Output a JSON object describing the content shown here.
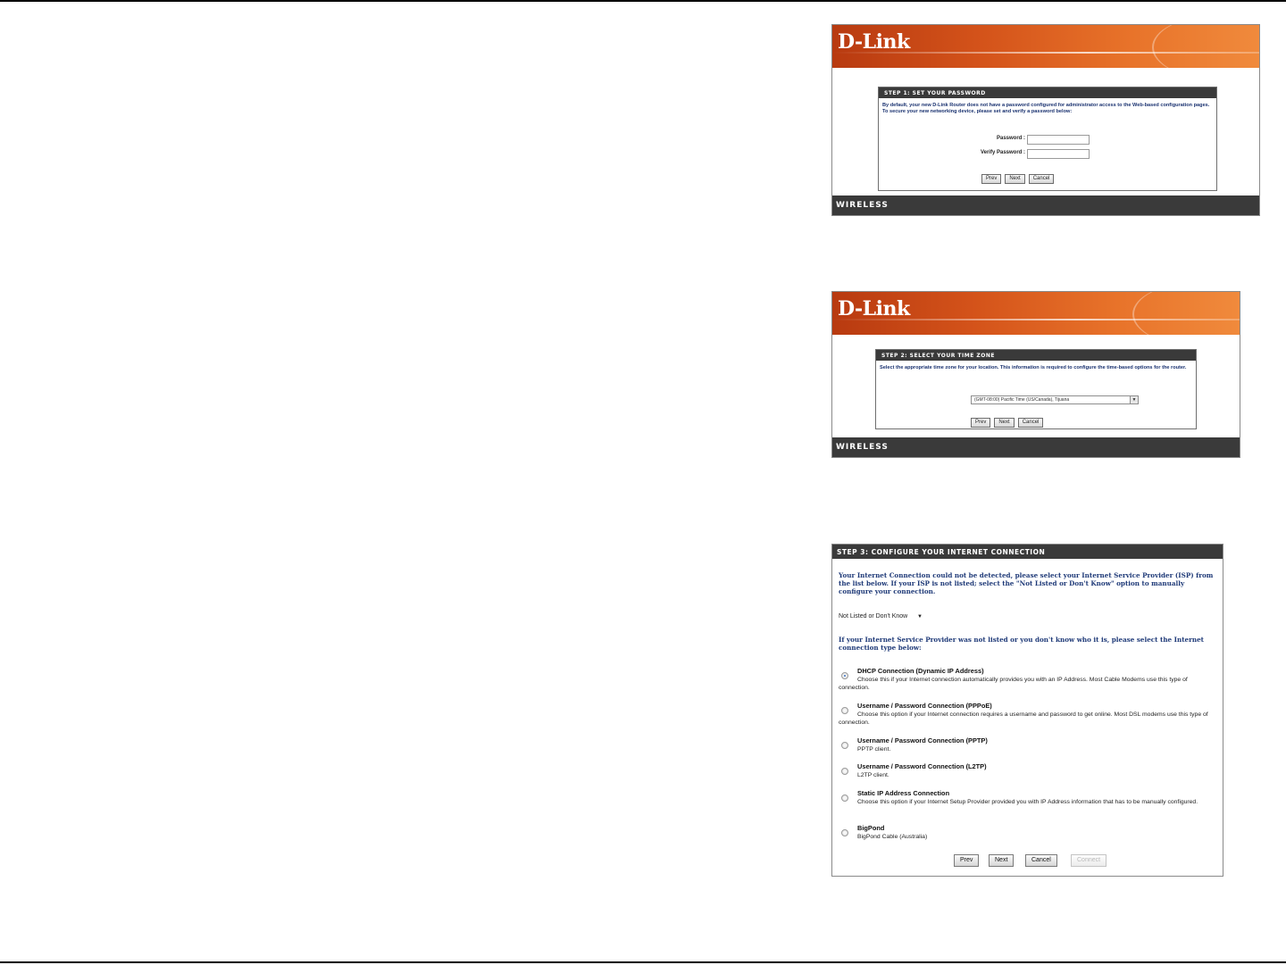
{
  "step1": {
    "logo": "D-Link",
    "heading": "STEP 1: SET YOUR PASSWORD",
    "description": "By default, your new D-Link Router does not have a password configured for administrator access to the Web-based configuration pages. To secure your new networking device, please set and verify a password below:",
    "password_label": "Password :",
    "verify_label": "Verify Password :",
    "password_value": "",
    "verify_value": "",
    "buttons": {
      "prev": "Prev",
      "next": "Next",
      "cancel": "Cancel"
    },
    "footer": "WIRELESS"
  },
  "step2": {
    "logo": "D-Link",
    "heading": "STEP 2: SELECT YOUR TIME ZONE",
    "description": "Select the appropriate time zone for your location. This information is required to configure the time-based options for the router.",
    "timezone_value": "(GMT-08:00) Pacific Time (US/Canada), Tijuana",
    "buttons": {
      "prev": "Prev",
      "next": "Next",
      "cancel": "Cancel"
    },
    "footer": "WIRELESS"
  },
  "step3": {
    "heading": "STEP 3: CONFIGURE YOUR INTERNET CONNECTION",
    "intro": "Your Internet Connection could not be detected, please select your Internet Service Provider (ISP) from the list below. If your ISP is not listed; select the \"Not Listed or Don't Know\" option to manually configure your connection.",
    "isp_select_value": "Not Listed or Don't Know",
    "instruction": "If your Internet Service Provider was not listed or you don't know who it is, please select the Internet connection type below:",
    "options": [
      {
        "title": "DHCP Connection (Dynamic IP Address)",
        "desc": "Choose this if your Internet connection automatically provides you with an IP Address. Most Cable Modems use this type of connection.",
        "selected": true
      },
      {
        "title": "Username / Password Connection (PPPoE)",
        "desc": "Choose this option if your Internet connection requires a username and password to get online. Most DSL modems use this type of connection.",
        "selected": false
      },
      {
        "title": "Username / Password Connection (PPTP)",
        "desc": "PPTP client.",
        "selected": false
      },
      {
        "title": "Username / Password Connection (L2TP)",
        "desc": "L2TP client.",
        "selected": false
      },
      {
        "title": "Static IP Address Connection",
        "desc": "Choose this option if your Internet Setup Provider provided you with IP Address information that has to be manually configured.",
        "selected": false
      },
      {
        "title": "BigPond",
        "desc": "BigPond Cable (Australia)",
        "selected": false
      }
    ],
    "buttons": {
      "prev": "Prev",
      "next": "Next",
      "cancel": "Cancel",
      "connect": "Connect"
    }
  }
}
